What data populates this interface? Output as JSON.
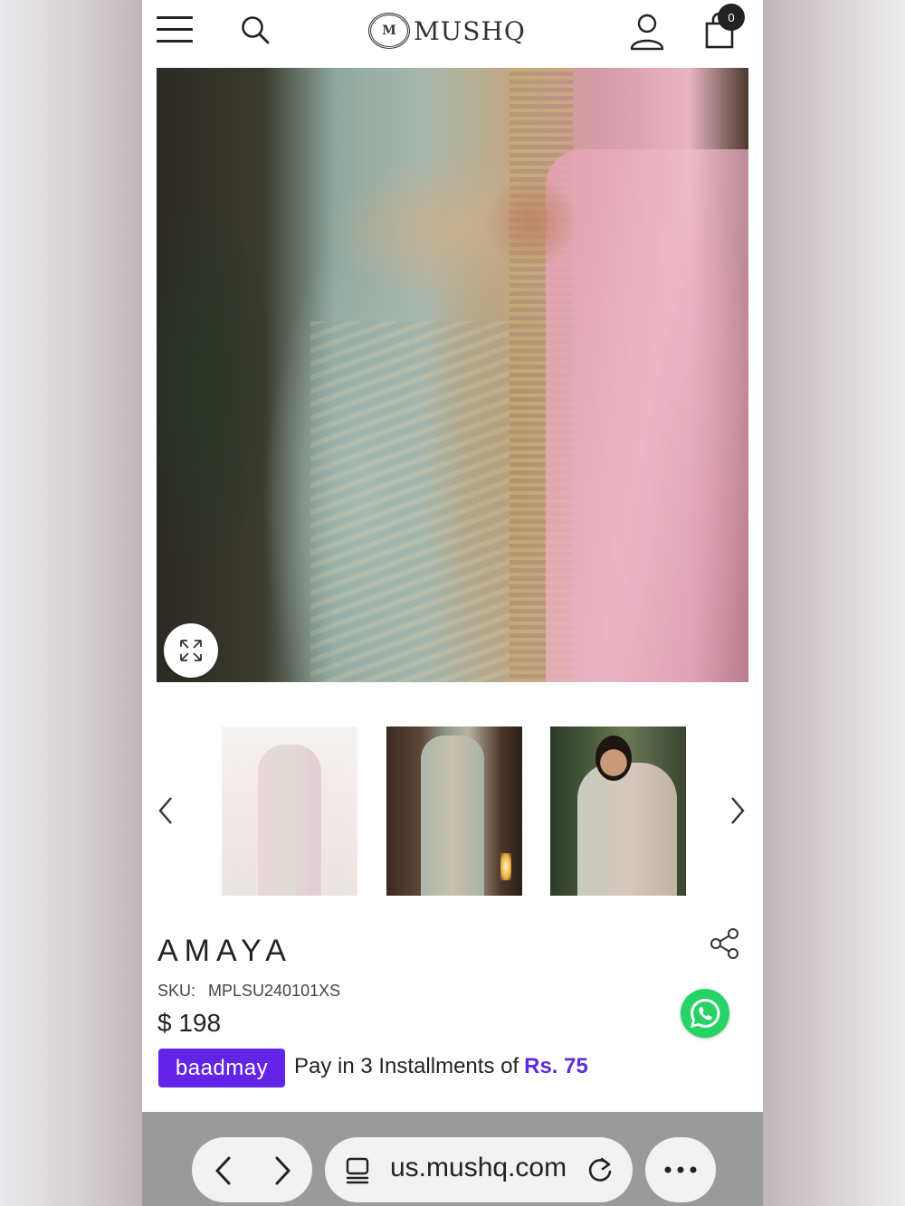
{
  "header": {
    "logo_mark": "M",
    "logo_text": "MUSHQ",
    "cart_count": "0"
  },
  "gallery": {
    "thumbnail_count_visible": 3,
    "zoom_icon": "expand-icon"
  },
  "product": {
    "title": "AMAYA",
    "sku_label": "SKU:",
    "sku_value": "MPLSU240101XS",
    "price": "$ 198"
  },
  "installments": {
    "provider": "baadmay",
    "text": "Pay in 3 Installments of",
    "amount": "Rs. 75",
    "accent_color": "#6224e6"
  },
  "browser": {
    "url": "us.mushq.com"
  },
  "icons": [
    "menu-icon",
    "search-icon",
    "user-icon",
    "cart-icon",
    "expand-icon",
    "chevron-left-icon",
    "chevron-right-icon",
    "share-icon",
    "whatsapp-icon",
    "tabs-icon",
    "reload-icon",
    "more-icon"
  ]
}
